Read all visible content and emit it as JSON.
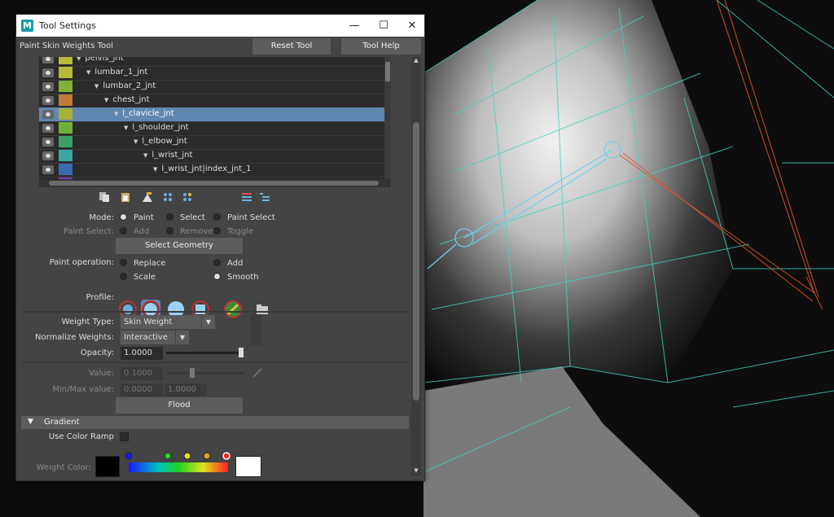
{
  "window": {
    "title": "Tool Settings",
    "logo": "M"
  },
  "tool": {
    "name": "Paint Skin Weights Tool",
    "reset_label": "Reset Tool",
    "help_label": "Tool Help"
  },
  "joints": [
    {
      "name": "pelvis_jnt",
      "color": "#b7b93a",
      "expanded": true,
      "selected": false
    },
    {
      "name": "lumbar_1_jnt",
      "color": "#b7b93a",
      "expanded": true,
      "selected": false
    },
    {
      "name": "lumbar_2_jnt",
      "color": "#7fb03a",
      "expanded": true,
      "selected": false
    },
    {
      "name": "chest_jnt",
      "color": "#c07a3a",
      "expanded": true,
      "selected": false
    },
    {
      "name": "l_clavicle_jnt",
      "color": "#a9b03a",
      "expanded": true,
      "selected": true
    },
    {
      "name": "l_shoulder_jnt",
      "color": "#6fb03a",
      "expanded": true,
      "selected": false
    },
    {
      "name": "l_elbow_jnt",
      "color": "#3aa06a",
      "expanded": true,
      "selected": false
    },
    {
      "name": "l_wrist_jnt",
      "color": "#3aa6a6",
      "expanded": true,
      "selected": false
    },
    {
      "name": "l_wrist_jnt|index_jnt_1",
      "color": "#3a6ab0",
      "expanded": true,
      "selected": false
    },
    {
      "name": "",
      "color": "#7a3ab0",
      "expanded": false,
      "selected": false
    }
  ],
  "mode": {
    "label": "Mode:",
    "options": [
      "Paint",
      "Select",
      "Paint Select"
    ],
    "selected": "Paint"
  },
  "paint_select": {
    "label": "Paint Select:",
    "options": [
      "Add",
      "Remove",
      "Toggle"
    ],
    "selected": "Add"
  },
  "select_geometry_label": "Select Geometry",
  "paint_operation": {
    "label": "Paint operation:",
    "options": [
      "Replace",
      "Add",
      "Scale",
      "Smooth"
    ],
    "selected": "Smooth"
  },
  "profile": {
    "label": "Profile:",
    "selected_index": 1
  },
  "weight_type": {
    "label": "Weight Type:",
    "value": "Skin Weight"
  },
  "normalize": {
    "label": "Normalize Weights:",
    "value": "Interactive"
  },
  "opacity": {
    "label": "Opacity:",
    "value": "1.0000",
    "level": 1.0
  },
  "value": {
    "label": "Value:",
    "value": "0.1000",
    "level": 0.1
  },
  "minmax": {
    "label": "Min/Max value:",
    "min": "0.0000",
    "max": "1.0000"
  },
  "flood_label": "Flood",
  "gradient": {
    "header": "Gradient",
    "use_color_ramp_label": "Use Color Ramp",
    "weight_color_label": "Weight Color:"
  }
}
